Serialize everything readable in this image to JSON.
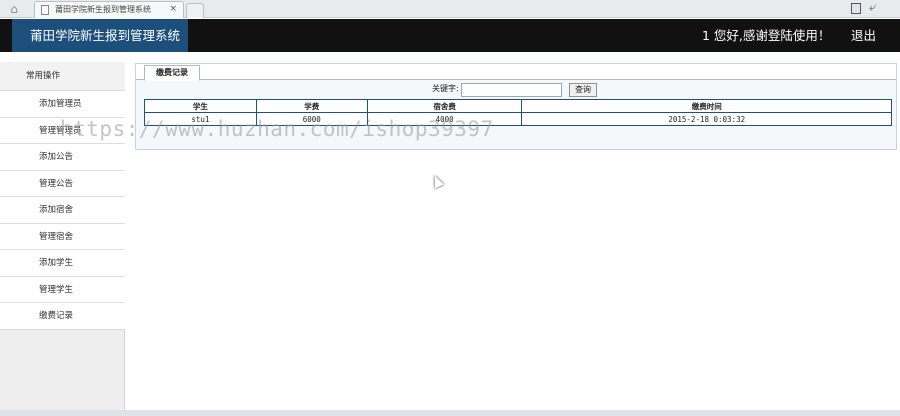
{
  "browser": {
    "home_icon": "home-icon",
    "tab_title": "莆田学院新生报到管理系统",
    "tab_close": "×"
  },
  "header": {
    "app_title": "莆田学院新生报到管理系统",
    "welcome": "1 您好,感谢登陆使用！",
    "logout": "退出"
  },
  "sidebar": {
    "heading": "常用操作",
    "items": [
      {
        "label": "添加管理员"
      },
      {
        "label": "管理管理员"
      },
      {
        "label": "添加公告"
      },
      {
        "label": "管理公告"
      },
      {
        "label": "添加宿舍"
      },
      {
        "label": "管理宿舍"
      },
      {
        "label": "添加学生"
      },
      {
        "label": "管理学生"
      },
      {
        "label": "缴费记录"
      }
    ]
  },
  "main": {
    "tab_label": "缴费记录",
    "search": {
      "label": "关键字:",
      "value": "",
      "button": "查询"
    },
    "table": {
      "headers": [
        "学生",
        "学费",
        "宿舍费",
        "缴费时间"
      ],
      "rows": [
        [
          "stu1",
          "6000",
          "4000",
          "2015-2-18 0:03:32"
        ]
      ]
    }
  },
  "watermark": "https://www.huzhan.com/ishop39397",
  "colors": {
    "header_bg": "#111111",
    "title_box": "#1c4f7c",
    "table_border": "#1f4f86"
  }
}
